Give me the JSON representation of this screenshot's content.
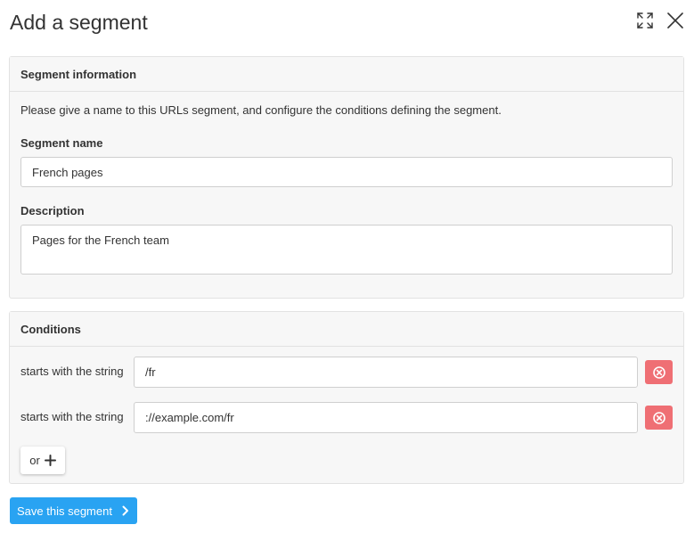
{
  "modal": {
    "title": "Add a segment",
    "expand_icon": "expand-icon",
    "close_icon": "close-icon"
  },
  "segment_info": {
    "header": "Segment information",
    "intro": "Please give a name to this URLs segment, and configure the conditions defining the segment.",
    "name_label": "Segment name",
    "name_value": "French pages",
    "description_label": "Description",
    "description_value": "Pages for the French team"
  },
  "conditions": {
    "header": "Conditions",
    "rows": [
      {
        "operator": "starts with the string",
        "value": "/fr",
        "remove_icon": "remove-circle-icon"
      },
      {
        "operator": "starts with the string",
        "value": "://example.com/fr",
        "remove_icon": "remove-circle-icon"
      }
    ],
    "or_button_label": "or",
    "or_icon": "plus-icon"
  },
  "footer": {
    "save_label": "Save this segment",
    "save_icon": "chevron-right-icon"
  },
  "colors": {
    "primary": "#29a3f2",
    "danger": "#ef6f74",
    "panel_bg": "#f7f7f7",
    "border": "#e2e2e2"
  }
}
